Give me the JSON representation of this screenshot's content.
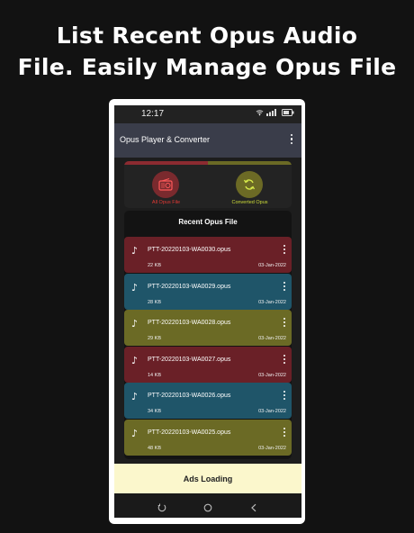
{
  "headline": {
    "line1": "List Recent Opus Audio",
    "line2": "File. Easily Manage Opus File"
  },
  "status_bar": {
    "time": "12:17",
    "icons": [
      "wifi-icon",
      "signal-icon",
      "battery-icon"
    ]
  },
  "app_bar": {
    "title": "Opus Player & Converter",
    "menu_icon": "more-vert-icon"
  },
  "top_actions": [
    {
      "label": "All Opus File",
      "icon": "radio-icon",
      "color": "#e53935",
      "bg": "#7a2a2e"
    },
    {
      "label": "Converted Opus",
      "icon": "sync-icon",
      "color": "#cddc39",
      "bg": "#6c6a25"
    }
  ],
  "recent": {
    "title": "Recent Opus File",
    "files": [
      {
        "name": "PTT-20220103-WA0030.opus",
        "size": "22 KB",
        "date": "03-Jan-2022",
        "color": "#6a2027"
      },
      {
        "name": "PTT-20220103-WA0029.opus",
        "size": "28 KB",
        "date": "03-Jan-2022",
        "color": "#1f5569"
      },
      {
        "name": "PTT-20220103-WA0028.opus",
        "size": "29 KB",
        "date": "03-Jan-2022",
        "color": "#6b6a25"
      },
      {
        "name": "PTT-20220103-WA0027.opus",
        "size": "14 KB",
        "date": "03-Jan-2022",
        "color": "#6a2027"
      },
      {
        "name": "PTT-20220103-WA0026.opus",
        "size": "34 KB",
        "date": "03-Jan-2022",
        "color": "#1f5569"
      },
      {
        "name": "PTT-20220103-WA0025.opus",
        "size": "48 KB",
        "date": "03-Jan-2022",
        "color": "#6b6a25"
      }
    ]
  },
  "ads": {
    "label": "Ads Loading"
  },
  "nav_bar": {
    "buttons": [
      "recent-apps-icon",
      "home-icon",
      "back-icon"
    ]
  }
}
